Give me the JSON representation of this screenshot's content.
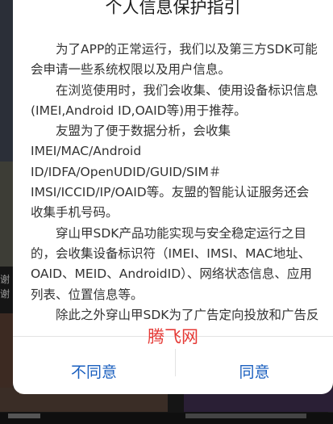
{
  "dialog": {
    "title": "个人信息保护指引",
    "paragraphs": [
      "为了APP的正常运行，我们以及第三方SDK可能会申请一些系统权限以及用户信息。",
      "在浏览使用时，我们会收集、使用设备标识信息(IMEI,Android ID,OAID等)用于推荐。",
      "友盟为了便于数据分析，会收集IMEI/MAC/Android ID/IDFA/OpenUDID/GUID/SIM＃IMSI/ICCID/IP/OAID等。友盟的智能认证服务还会收集手机号码。",
      "穿山甲SDK产品功能实现与安全稳定运行之目的，会收集设备标识符（IMEI、IMSI、MAC地址、OAID、MEID、AndroidID）、网络状态信息、应用列表、位置信息等。",
      "除此之外穿山甲SDK为了广告定向投放和广告反作弊，会通过读取设备wifi列表、wifi的BSSID、"
    ],
    "watermark": "腾飞网",
    "disagree_label": "不同意",
    "agree_label": "同意"
  },
  "background": {
    "left_text_1": "谢",
    "left_text_2": "谢"
  },
  "colors": {
    "button_text": "#1a5fbf",
    "watermark": "#e53935",
    "dialog_bg": "#ffffff",
    "overlay_bg": "#151515"
  }
}
